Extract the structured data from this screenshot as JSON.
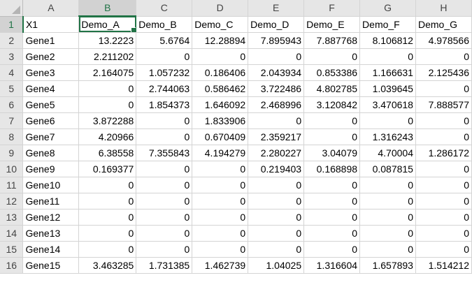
{
  "columns": [
    "A",
    "B",
    "C",
    "D",
    "E",
    "F",
    "G",
    "H"
  ],
  "active_column": "B",
  "active_row": 1,
  "rows": [
    {
      "num": "1",
      "cells": [
        "X1",
        "Demo_A",
        "Demo_B",
        "Demo_C",
        "Demo_D",
        "Demo_E",
        "Demo_F",
        "Demo_G"
      ]
    },
    {
      "num": "2",
      "cells": [
        "Gene1",
        "13.2223",
        "5.6764",
        "12.28894",
        "7.895943",
        "7.887768",
        "8.106812",
        "4.978566"
      ]
    },
    {
      "num": "3",
      "cells": [
        "Gene2",
        "2.211202",
        "0",
        "0",
        "0",
        "0",
        "0",
        "0"
      ]
    },
    {
      "num": "4",
      "cells": [
        "Gene3",
        "2.164075",
        "1.057232",
        "0.186406",
        "2.043934",
        "0.853386",
        "1.166631",
        "2.125436"
      ]
    },
    {
      "num": "5",
      "cells": [
        "Gene4",
        "0",
        "2.744063",
        "0.586462",
        "3.722486",
        "4.802785",
        "1.039645",
        "0"
      ]
    },
    {
      "num": "6",
      "cells": [
        "Gene5",
        "0",
        "1.854373",
        "1.646092",
        "2.468996",
        "3.120842",
        "3.470618",
        "7.888577"
      ]
    },
    {
      "num": "7",
      "cells": [
        "Gene6",
        "3.872288",
        "0",
        "1.833906",
        "0",
        "0",
        "0",
        "0"
      ]
    },
    {
      "num": "8",
      "cells": [
        "Gene7",
        "4.20966",
        "0",
        "0.670409",
        "2.359217",
        "0",
        "1.316243",
        "0"
      ]
    },
    {
      "num": "9",
      "cells": [
        "Gene8",
        "6.38558",
        "7.355843",
        "4.194279",
        "2.280227",
        "3.04079",
        "4.70004",
        "1.286172"
      ]
    },
    {
      "num": "10",
      "cells": [
        "Gene9",
        "0.169377",
        "0",
        "0",
        "0.219403",
        "0.168898",
        "0.087815",
        "0"
      ]
    },
    {
      "num": "11",
      "cells": [
        "Gene10",
        "0",
        "0",
        "0",
        "0",
        "0",
        "0",
        "0"
      ]
    },
    {
      "num": "12",
      "cells": [
        "Gene11",
        "0",
        "0",
        "0",
        "0",
        "0",
        "0",
        "0"
      ]
    },
    {
      "num": "13",
      "cells": [
        "Gene12",
        "0",
        "0",
        "0",
        "0",
        "0",
        "0",
        "0"
      ]
    },
    {
      "num": "14",
      "cells": [
        "Gene13",
        "0",
        "0",
        "0",
        "0",
        "0",
        "0",
        "0"
      ]
    },
    {
      "num": "15",
      "cells": [
        "Gene14",
        "0",
        "0",
        "0",
        "0",
        "0",
        "0",
        "0"
      ]
    },
    {
      "num": "16",
      "cells": [
        "Gene15",
        "3.463285",
        "1.731385",
        "1.462739",
        "1.04025",
        "1.316604",
        "1.657893",
        "1.514212"
      ]
    }
  ]
}
